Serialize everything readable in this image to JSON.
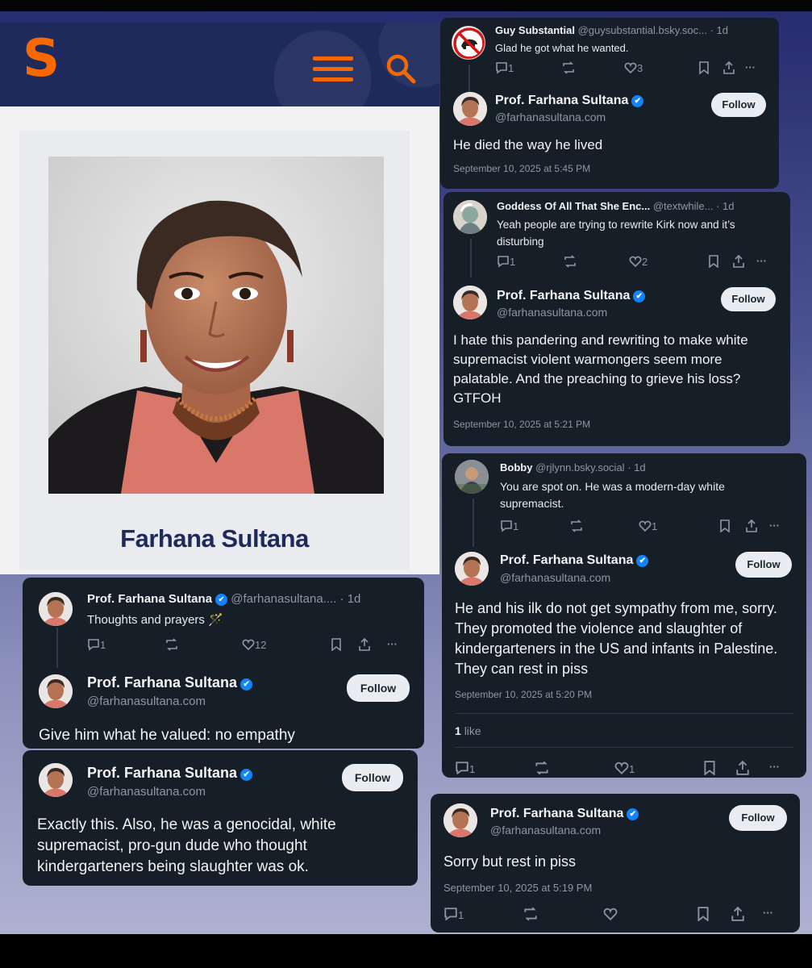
{
  "profile_page": {
    "name": "Farhana Sultana",
    "logo_letter": "S"
  },
  "posts": {
    "guy": {
      "name": "Guy Substantial",
      "handle": "@guysubstantial.bsky.soc...",
      "time": "· 1d",
      "text": "Glad he got what he wanted.",
      "replies": "1",
      "likes": "3"
    },
    "reply1": {
      "name": "Prof. Farhana Sultana",
      "handle": "@farhanasultana.com",
      "follow": "Follow",
      "text": "He died the way he lived",
      "timestamp": "September 10, 2025 at 5:45 PM"
    },
    "goddess": {
      "name": "Goddess Of All That She Enc...",
      "handle": "@textwhile...",
      "time": "· 1d",
      "text": "Yeah people are trying to rewrite Kirk now and it’s disturbing",
      "replies": "1",
      "likes": "2"
    },
    "reply2": {
      "name": "Prof. Farhana Sultana",
      "handle": "@farhanasultana.com",
      "follow": "Follow",
      "text": "I hate this pandering and rewriting to make white supremacist violent warmongers seem more palatable. And the preaching to grieve his loss? GTFOH",
      "timestamp": "September 10, 2025 at 5:21 PM"
    },
    "bobby": {
      "name": "Bobby",
      "handle": "@rjlynn.bsky.social",
      "time": "· 1d",
      "text": "You are spot on. He was a modern-day white supremacist.",
      "replies": "1",
      "likes": "1"
    },
    "reply3": {
      "name": "Prof. Farhana Sultana",
      "handle": "@farhanasultana.com",
      "follow": "Follow",
      "text": "He and his ilk do not get sympathy from me, sorry. They promoted the violence and slaughter of kindergarteners in the US and infants in Palestine. They can rest in piss",
      "timestamp": "September 10, 2025 at 5:20 PM",
      "likes_count": "1",
      "likes_label": "like",
      "replies": "1",
      "likes": "1"
    },
    "thoughts": {
      "name": "Prof. Farhana Sultana",
      "handle": "@farhanasultana....",
      "time": "· 1d",
      "text": "Thoughts and prayers 🪄",
      "replies": "1",
      "likes": "12"
    },
    "reply4": {
      "name": "Prof. Farhana Sultana",
      "handle": "@farhanasultana.com",
      "follow": "Follow",
      "text": "Give him what he valued: no empathy"
    },
    "reply5": {
      "name": "Prof. Farhana Sultana",
      "handle": "@farhanasultana.com",
      "follow": "Follow",
      "text": "Exactly this. Also, he was a genocidal, white supremacist, pro-gun dude who thought kindergarteners being slaughter was ok."
    },
    "reply6": {
      "name": "Prof. Farhana Sultana",
      "handle": "@farhanasultana.com",
      "follow": "Follow",
      "text": "Sorry but rest in piss",
      "timestamp": "September 10, 2025 at 5:19 PM",
      "replies": "1"
    }
  },
  "colors": {
    "syracuse_orange": "#f76900",
    "syracuse_navy": "#1e2a5c",
    "card_bg": "#161e27",
    "verified_blue": "#1083fe"
  }
}
